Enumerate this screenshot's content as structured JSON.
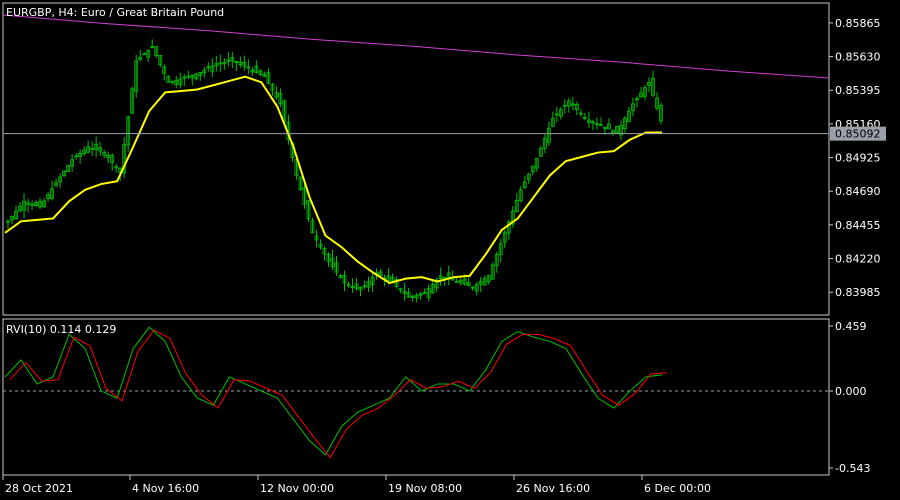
{
  "header": {
    "title": "EURGBP, H4:  Euro / Great Britain Pound"
  },
  "price_pane": {
    "y_ticks": [
      "0.85865",
      "0.85630",
      "0.85395",
      "0.85160",
      "0.84925",
      "0.84690",
      "0.84455",
      "0.84220",
      "0.83985"
    ],
    "current_price": "0.85092",
    "current_value": 0.85092,
    "ylim": [
      0.8384,
      0.8599
    ],
    "colors": {
      "bull": "#00c000",
      "bear": "#00c000",
      "ma": "#ffff00",
      "trendline": "#d040d0",
      "price_line": "#9aa0a8",
      "grid": "#c8c8c8"
    }
  },
  "indicator": {
    "label": "RVI(10) 0.114 0.129",
    "y_ticks": [
      "0.459",
      "0.000",
      "-0.543"
    ],
    "ylim": [
      -0.543,
      0.459
    ],
    "colors": {
      "main": "#00c000",
      "signal": "#ff0000",
      "zero": "#9aa0a8"
    }
  },
  "x_axis": {
    "labels": [
      "28 Oct 2021",
      "4 Nov 16:00",
      "12 Nov 00:00",
      "19 Nov 08:00",
      "26 Nov 16:00",
      "6 Dec 00:00"
    ]
  },
  "chart_data": [
    {
      "type": "line",
      "title": "EURGBP, H4:  Euro / Great Britain Pound",
      "x": [
        0,
        4,
        8,
        12,
        16,
        20,
        24,
        28,
        32,
        36,
        40,
        44,
        48,
        52,
        56,
        60,
        64,
        68,
        72,
        76,
        80,
        84,
        88,
        92,
        96,
        100,
        104,
        108,
        112,
        116,
        120,
        124,
        128,
        132,
        136,
        140,
        144,
        148,
        152,
        156,
        160,
        164
      ],
      "x_tick_labels": [
        "28 Oct 2021",
        "4 Nov 16:00",
        "12 Nov 00:00",
        "19 Nov 08:00",
        "26 Nov 16:00",
        "6 Dec 00:00"
      ],
      "series": [
        {
          "values": [
            0.8448,
            0.8462,
            0.8458,
            0.8475,
            0.8491,
            0.85,
            0.8496,
            0.8482,
            0.856,
            0.857,
            0.8545,
            0.8548,
            0.8552,
            0.8558,
            0.856,
            0.8555,
            0.8549,
            0.853,
            0.848,
            0.844,
            0.842,
            0.8405,
            0.84,
            0.8412,
            0.8405,
            0.8395,
            0.8398,
            0.841,
            0.8406,
            0.8402,
            0.841,
            0.844,
            0.847,
            0.8492,
            0.852,
            0.8532,
            0.852,
            0.8515,
            0.851,
            0.853,
            0.8545,
            0.8509
          ]
        },
        {
          "values": [
            0.844,
            0.8448,
            0.8449,
            0.845,
            0.8462,
            0.847,
            0.8474,
            0.8476,
            0.85,
            0.8525,
            0.8538,
            0.8539,
            0.854,
            0.8543,
            0.8546,
            0.8549,
            0.8545,
            0.8528,
            0.85,
            0.8465,
            0.8438,
            0.843,
            0.842,
            0.8412,
            0.8405,
            0.8408,
            0.8409,
            0.8406,
            0.8409,
            0.841,
            0.8425,
            0.8442,
            0.845,
            0.8465,
            0.848,
            0.849,
            0.8493,
            0.8496,
            0.8497,
            0.8505,
            0.851,
            0.851
          ]
        },
        {
          "values": [
            0.8592,
            0.8586,
            0.8581,
            0.8575,
            0.857,
            0.8564,
            0.8559,
            0.8553,
            0.8548
          ]
        }
      ],
      "ylim": [
        0.8384,
        0.8599
      ]
    },
    {
      "type": "line",
      "title": "RVI(10) 0.114 0.129",
      "x": [
        0,
        4,
        8,
        12,
        16,
        20,
        24,
        28,
        32,
        36,
        40,
        44,
        48,
        52,
        56,
        60,
        64,
        68,
        72,
        76,
        80,
        84,
        88,
        92,
        96,
        100,
        104,
        108,
        112,
        116,
        120,
        124,
        128,
        132,
        136,
        140,
        144,
        148,
        152,
        156,
        160,
        164
      ],
      "series": [
        {
          "values": [
            0.1,
            0.22,
            0.05,
            0.1,
            0.4,
            0.3,
            0.0,
            -0.05,
            0.3,
            0.45,
            0.35,
            0.1,
            -0.05,
            -0.1,
            0.1,
            0.05,
            0.0,
            -0.05,
            -0.2,
            -0.35,
            -0.45,
            -0.25,
            -0.15,
            -0.1,
            -0.05,
            0.1,
            0.0,
            0.05,
            0.05,
            0.0,
            0.15,
            0.35,
            0.42,
            0.38,
            0.35,
            0.3,
            0.12,
            -0.05,
            -0.12,
            0.0,
            0.1,
            0.114
          ]
        },
        {
          "values": [
            0.08,
            0.2,
            0.07,
            0.08,
            0.38,
            0.32,
            0.02,
            -0.07,
            0.28,
            0.43,
            0.37,
            0.12,
            -0.03,
            -0.12,
            0.08,
            0.07,
            0.02,
            -0.03,
            -0.18,
            -0.33,
            -0.47,
            -0.27,
            -0.17,
            -0.12,
            -0.03,
            0.08,
            0.02,
            0.03,
            0.07,
            0.02,
            0.13,
            0.33,
            0.4,
            0.4,
            0.37,
            0.32,
            0.14,
            -0.03,
            -0.1,
            -0.02,
            0.12,
            0.129
          ]
        }
      ],
      "ylim": [
        -0.543,
        0.459
      ]
    }
  ]
}
